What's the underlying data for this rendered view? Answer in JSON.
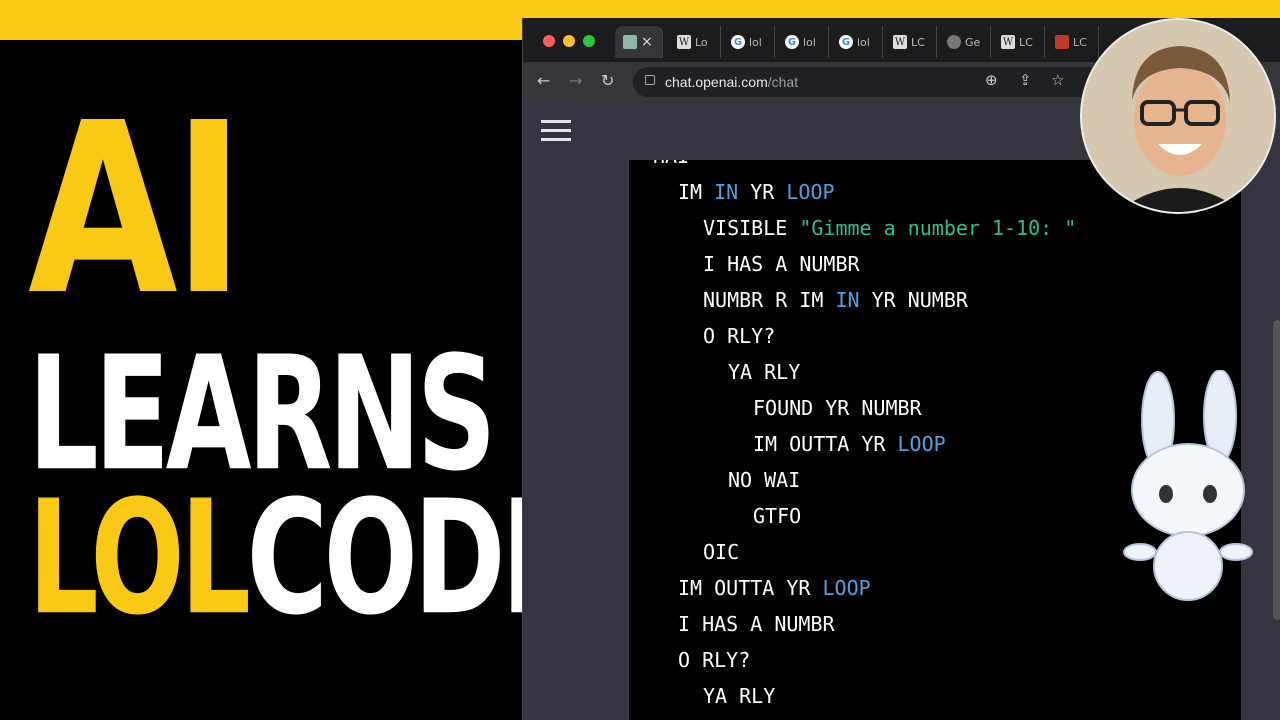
{
  "headline": {
    "line1": "AI",
    "line2": "LEARNS",
    "line3_a": "LOL",
    "line3_b": "CODE"
  },
  "colors": {
    "yellow": "#f9c916",
    "keyword": "#4ea1e4",
    "string": "#2fbf8f"
  },
  "browser": {
    "tabs": [
      {
        "icon": "chatgpt-favicon",
        "title": ""
      },
      {
        "icon": "wikipedia-favicon",
        "title": "Lo"
      },
      {
        "icon": "google-favicon",
        "title": "lol"
      },
      {
        "icon": "google-favicon",
        "title": "lol"
      },
      {
        "icon": "google-favicon",
        "title": "lol"
      },
      {
        "icon": "wikipedia-favicon",
        "title": "LC"
      },
      {
        "icon": "globe-favicon",
        "title": "Ge"
      },
      {
        "icon": "wikipedia-favicon",
        "title": "LC"
      },
      {
        "icon": "red-favicon",
        "title": "LC"
      }
    ],
    "url_host": "chat.openai.com",
    "url_path": "/chat"
  },
  "code_lines": [
    {
      "indent": 0,
      "parts": [
        {
          "t": "HAI",
          "c": "p"
        }
      ]
    },
    {
      "indent": 1,
      "parts": [
        {
          "t": "IM ",
          "c": "p"
        },
        {
          "t": "IN",
          "c": "k"
        },
        {
          "t": " YR ",
          "c": "p"
        },
        {
          "t": "LOOP",
          "c": "k"
        }
      ]
    },
    {
      "indent": 2,
      "parts": [
        {
          "t": "VISIBLE ",
          "c": "p"
        },
        {
          "t": "\"Gimme a number 1-10: \"",
          "c": "s"
        }
      ]
    },
    {
      "indent": 2,
      "parts": [
        {
          "t": "I HAS A NUMBR",
          "c": "p"
        }
      ]
    },
    {
      "indent": 2,
      "parts": [
        {
          "t": "NUMBR R IM ",
          "c": "p"
        },
        {
          "t": "IN",
          "c": "k"
        },
        {
          "t": " YR NUMBR",
          "c": "p"
        }
      ]
    },
    {
      "indent": 2,
      "parts": [
        {
          "t": "O RLY?",
          "c": "p"
        }
      ]
    },
    {
      "indent": 3,
      "parts": [
        {
          "t": "YA RLY",
          "c": "p"
        }
      ]
    },
    {
      "indent": 4,
      "parts": [
        {
          "t": "FOUND YR NUMBR",
          "c": "p"
        }
      ]
    },
    {
      "indent": 4,
      "parts": [
        {
          "t": "IM OUTTA YR ",
          "c": "p"
        },
        {
          "t": "LOOP",
          "c": "k"
        }
      ]
    },
    {
      "indent": 3,
      "parts": [
        {
          "t": "NO WAI",
          "c": "p"
        }
      ]
    },
    {
      "indent": 4,
      "parts": [
        {
          "t": "GTFO",
          "c": "p"
        }
      ]
    },
    {
      "indent": 2,
      "parts": [
        {
          "t": "OIC",
          "c": "p"
        }
      ]
    },
    {
      "indent": 1,
      "parts": [
        {
          "t": "IM OUTTA YR ",
          "c": "p"
        },
        {
          "t": "LOOP",
          "c": "k"
        }
      ]
    },
    {
      "indent": 1,
      "parts": [
        {
          "t": "I HAS A NUMBR",
          "c": "p"
        }
      ]
    },
    {
      "indent": 1,
      "parts": [
        {
          "t": "O RLY?",
          "c": "p"
        }
      ]
    },
    {
      "indent": 2,
      "parts": [
        {
          "t": "YA RLY",
          "c": "p"
        }
      ]
    }
  ]
}
